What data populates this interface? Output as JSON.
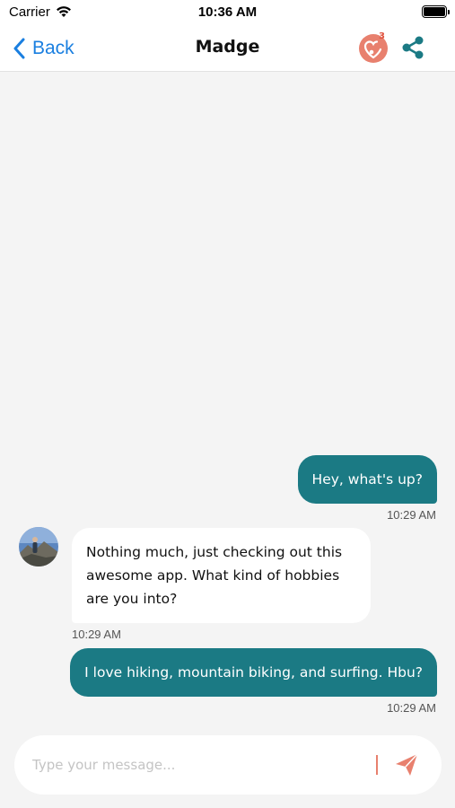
{
  "status_bar": {
    "carrier": "Carrier",
    "time": "10:36 AM"
  },
  "nav": {
    "back_label": "Back",
    "title": "Madge",
    "likes_count": "3"
  },
  "messages": [
    {
      "direction": "outgoing",
      "text": "Hey, what's up?",
      "time": "10:29 AM"
    },
    {
      "direction": "incoming",
      "text": "Nothing much, just checking out this awesome app. What kind of hobbies are you into?",
      "time": "10:29 AM"
    },
    {
      "direction": "outgoing",
      "text": "I love hiking, mountain biking, and surfing. Hbu?",
      "time": "10:29 AM"
    }
  ],
  "composer": {
    "placeholder": "Type your message..."
  },
  "colors": {
    "accent": "#1a7fe0",
    "outgoing_bubble": "#1b7a84",
    "brand_coral": "#e8806e"
  },
  "icons": {
    "back": "chevron-left-icon",
    "likes": "heart-badge-icon",
    "share": "share-nodes-icon",
    "send": "paper-plane-icon"
  }
}
